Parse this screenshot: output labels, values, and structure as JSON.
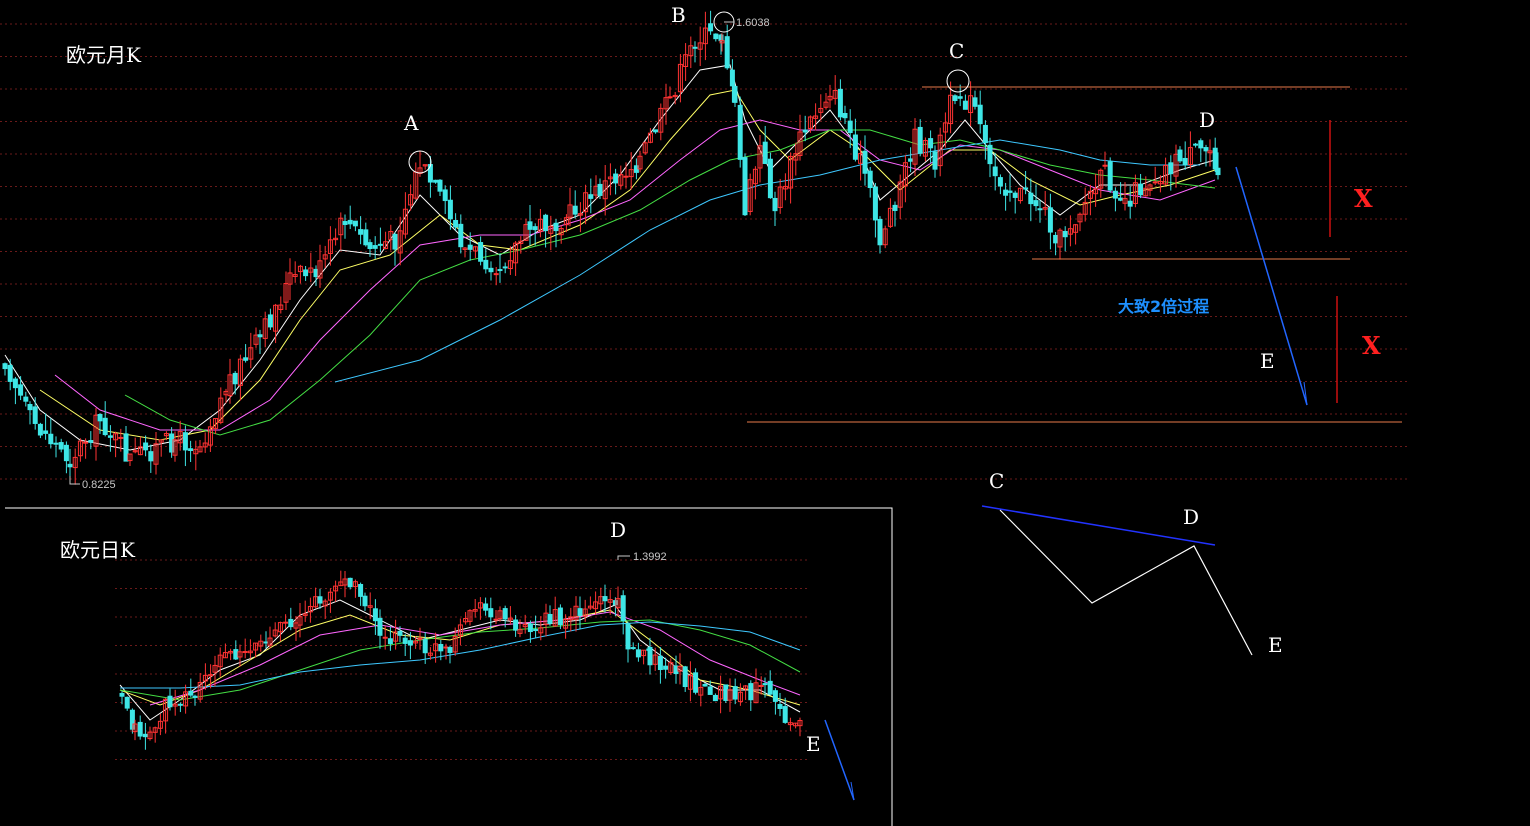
{
  "colors": {
    "background": "#000000",
    "up_candle": "#ff3333",
    "down_candle": "#3ee6e6",
    "grid": "#6a1a1a",
    "hline": "#e87a4a",
    "ma_white": "#ffffff",
    "ma_yellow": "#ffff66",
    "ma_pink": "#ff66ff",
    "ma_green": "#44dd44",
    "ma_blue": "#3ec8ff",
    "note": "#1e90ff",
    "x_mark": "#ff2020",
    "cd_line": "#2233ff"
  },
  "chart_data": [
    {
      "type": "candlestick",
      "title": "欧元月K",
      "pivots": [
        {
          "label": "A",
          "price": null
        },
        {
          "label": "B",
          "price": "1.6038"
        },
        {
          "label": "C",
          "price": null
        },
        {
          "label": "D",
          "price": null
        },
        {
          "label": "E",
          "price": null
        }
      ],
      "low_label": "0.8225",
      "high_label": "1.6038",
      "annotation": "大致2倍过程",
      "range_marks": [
        "X",
        "X"
      ]
    },
    {
      "type": "candlestick",
      "title": "欧元日K",
      "pivots": [
        {
          "label": "D",
          "price": "1.3992"
        },
        {
          "label": "E",
          "price": null
        }
      ],
      "high_label": "1.3992"
    },
    {
      "type": "line",
      "title": "",
      "points": [
        "C",
        "D",
        "E"
      ]
    }
  ],
  "labels": {
    "monthly_title": "欧元月K",
    "daily_title": "欧元日K",
    "A": "A",
    "B": "B",
    "C": "C",
    "D": "D",
    "E": "E",
    "b_price": "1.6038",
    "low_price": "0.8225",
    "daily_high": "1.3992",
    "note": "大致2倍过程",
    "x1": "X",
    "x2": "X",
    "daily_D": "D",
    "daily_E": "E",
    "schema_C": "C",
    "schema_D": "D",
    "schema_E": "E"
  }
}
